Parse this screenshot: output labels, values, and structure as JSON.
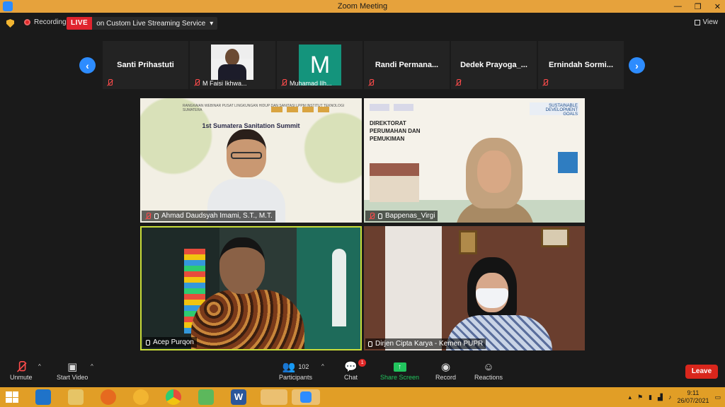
{
  "window": {
    "title": "Zoom Meeting"
  },
  "status": {
    "recording_label": "Recording",
    "live_badge": "LIVE",
    "live_service": "on Custom Live Streaming Service",
    "view_label": "View"
  },
  "strip": {
    "tiles": [
      {
        "name": "Santi Prihastuti",
        "caption": ""
      },
      {
        "name": "",
        "caption": "M Faisi Ikhwa..."
      },
      {
        "name": "",
        "caption": "Muhamad Ilh...",
        "avatar_letter": "M"
      },
      {
        "name": "Randi  Permana...",
        "caption": ""
      },
      {
        "name": "Dedek  Prayoga_...",
        "caption": ""
      },
      {
        "name": "Ernindah  Sormi...",
        "caption": ""
      }
    ]
  },
  "videos": {
    "v1": {
      "label": "Ahmad Daudsyah Imami, S.T., M.T.",
      "slide_title": "1st Sumatera Sanitation Summit",
      "slide_small": "RANGKAIAN WEBINAR PUSAT LINGKUNGAN HIDUP DAN SANITASI LPPM INSTITUT TEKNOLOGI SUMATERA"
    },
    "v2": {
      "label": "Bappenas_Virgi",
      "heading_line1": "DIREKTORAT",
      "heading_line2": "PERUMAHAN DAN",
      "heading_line3": "PEMUKIMAN",
      "sdg_label": "SUSTAINABLE DEVELOPMENT GOALS"
    },
    "v3": {
      "label": "Acep Purqon"
    },
    "v4": {
      "label": "Dirjen Cipta Karya - Kemen PUPR"
    }
  },
  "toolbar": {
    "unmute": "Unmute",
    "start_video": "Start Video",
    "participants": "Participants",
    "participants_count": "102",
    "chat": "Chat",
    "chat_badge": "1",
    "share_screen": "Share Screen",
    "record": "Record",
    "reactions": "Reactions",
    "leave": "Leave"
  },
  "taskbar": {
    "time": "9:11",
    "date": "26/07/2021"
  },
  "colors": {
    "accent_blue": "#2d8cff",
    "live_red": "#e0242e",
    "leave_red": "#d9261c",
    "share_green": "#22c55e",
    "taskbar_orange": "#e19e26",
    "active_speaker": "#c9dd3a"
  }
}
